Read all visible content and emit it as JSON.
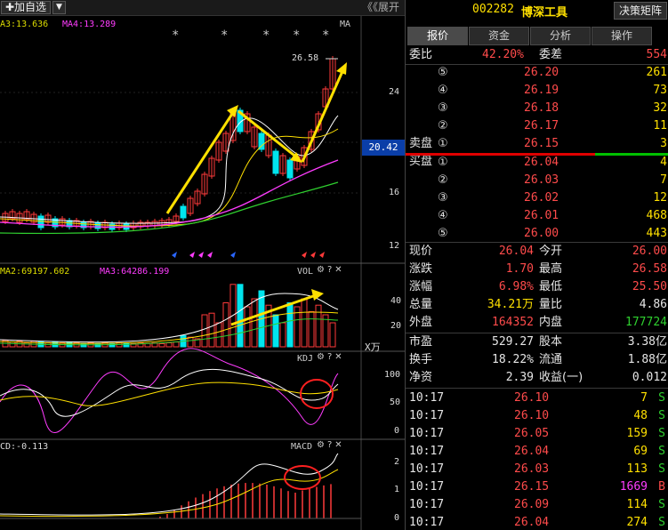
{
  "toolbar": {
    "add_favorite": "✚加自选",
    "dropdown": "▼",
    "expand": "《《展开"
  },
  "main_pane": {
    "ma_label_a": "A3:13.636",
    "ma_label_b": "MA4:13.289",
    "ma_tag": "MA",
    "high_label": "26.58",
    "current_price_tag": "20.42",
    "axis": [
      "24",
      "20",
      "16",
      "12"
    ],
    "stars": "*"
  },
  "vol_pane": {
    "label_a": "MA2:69197.602",
    "label_b": "MA3:64286.199",
    "name": "VOL",
    "axis": [
      "40",
      "20"
    ],
    "unit": "X万"
  },
  "kdj_pane": {
    "name": "KDJ",
    "axis": [
      "100",
      "50",
      "0"
    ]
  },
  "macd_pane": {
    "label": "CD:-0.113",
    "name": "MACD",
    "axis": [
      "2",
      "1",
      "0"
    ]
  },
  "tool_icons": {
    "gear": "⚙",
    "question": "?",
    "close": "✕"
  },
  "quote": {
    "code": "002282",
    "name": "博深工具",
    "matrix_button": "决策矩阵",
    "tabs": [
      "报价",
      "资金",
      "分析",
      "操作"
    ],
    "weibi": {
      "label": "委比",
      "value": "42.20%",
      "label2": "委差",
      "value2": "554"
    },
    "sell_label": "卖盘",
    "buy_label": "买盘",
    "asks": [
      {
        "level": "⑤",
        "price": "26.20",
        "vol": "261"
      },
      {
        "level": "④",
        "price": "26.19",
        "vol": "73"
      },
      {
        "level": "③",
        "price": "26.18",
        "vol": "32"
      },
      {
        "level": "②",
        "price": "26.17",
        "vol": "11"
      },
      {
        "level": "①",
        "price": "26.15",
        "vol": "3"
      }
    ],
    "bids": [
      {
        "level": "①",
        "price": "26.04",
        "vol": "4"
      },
      {
        "level": "②",
        "price": "26.03",
        "vol": "7"
      },
      {
        "level": "③",
        "price": "26.02",
        "vol": "12"
      },
      {
        "level": "④",
        "price": "26.01",
        "vol": "468"
      },
      {
        "level": "⑤",
        "price": "26.00",
        "vol": "443"
      }
    ],
    "stats": [
      {
        "l1": "现价",
        "v1": "26.04",
        "c1": "red",
        "l2": "今开",
        "v2": "26.00",
        "c2": "red"
      },
      {
        "l1": "涨跌",
        "v1": "1.70",
        "c1": "red",
        "l2": "最高",
        "v2": "26.58",
        "c2": "red"
      },
      {
        "l1": "涨幅",
        "v1": "6.98%",
        "c1": "red",
        "l2": "最低",
        "v2": "25.50",
        "c2": "red"
      },
      {
        "l1": "总量",
        "v1": "34.21万",
        "c1": "yel",
        "l2": "量比",
        "v2": "4.86",
        "c2": "wht"
      },
      {
        "l1": "外盘",
        "v1": "164352",
        "c1": "red",
        "l2": "内盘",
        "v2": "177724",
        "c2": "grn"
      }
    ],
    "fund": [
      {
        "l1": "市盈",
        "v1": "529.27",
        "l2": "股本",
        "v2": "3.38亿"
      },
      {
        "l1": "换手",
        "v1": "18.22%",
        "l2": "流通",
        "v2": "1.88亿"
      },
      {
        "l1": "净资",
        "v1": "2.39",
        "l2": "收益(一)",
        "v2": "0.012"
      }
    ],
    "ticks": [
      {
        "time": "10:17",
        "price": "26.10",
        "vol": "7",
        "side": "S",
        "vc": "yel",
        "sc": "grn"
      },
      {
        "time": "10:17",
        "price": "26.10",
        "vol": "48",
        "side": "S",
        "vc": "yel",
        "sc": "grn"
      },
      {
        "time": "10:17",
        "price": "26.05",
        "vol": "159",
        "side": "S",
        "vc": "yel",
        "sc": "grn"
      },
      {
        "time": "10:17",
        "price": "26.04",
        "vol": "69",
        "side": "S",
        "vc": "yel",
        "sc": "grn"
      },
      {
        "time": "10:17",
        "price": "26.03",
        "vol": "113",
        "side": "S",
        "vc": "yel",
        "sc": "grn"
      },
      {
        "time": "10:17",
        "price": "26.15",
        "vol": "1669",
        "side": "B",
        "vc": "mag",
        "sc": "red"
      },
      {
        "time": "10:17",
        "price": "26.09",
        "vol": "114",
        "side": "S",
        "vc": "yel",
        "sc": "grn"
      },
      {
        "time": "10:17",
        "price": "26.04",
        "vol": "274",
        "side": "S",
        "vc": "yel",
        "sc": "grn"
      }
    ]
  },
  "colors": {
    "up": "#ff4b4b",
    "down": "#2fd02f",
    "accent": "#ffe000",
    "cyan": "#00e5ee",
    "magenta": "#ff3cff",
    "tag_blue": "#0a3ea8"
  }
}
